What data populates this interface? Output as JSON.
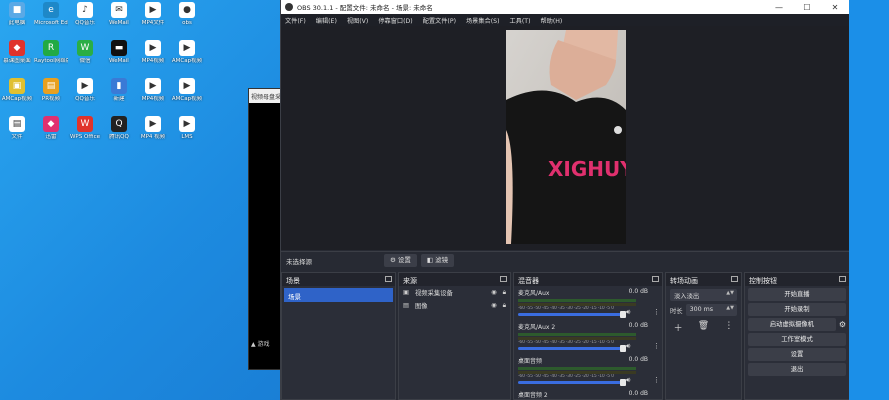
{
  "desktop": {
    "icons": [
      {
        "label": "此电脑",
        "color": "#5aa9e6",
        "glyph": "■"
      },
      {
        "label": "Microsoft Edge",
        "color": "#1e88c8",
        "glyph": "e"
      },
      {
        "label": "QQ音乐",
        "color": "#ffffff",
        "glyph": "♪"
      },
      {
        "label": "WeMail",
        "color": "#ffffff",
        "glyph": "✉"
      },
      {
        "label": "MP4文件",
        "color": "#ffffff",
        "glyph": "▶"
      },
      {
        "label": "obs",
        "color": "#ffffff",
        "glyph": "●"
      },
      {
        "label": "慕课图桌面",
        "color": "#e0332b",
        "glyph": "◆"
      },
      {
        "label": "Raytool网络版",
        "color": "#22aa44",
        "glyph": "R"
      },
      {
        "label": "微信",
        "color": "#2aae45",
        "glyph": "W"
      },
      {
        "label": "WeMail",
        "color": "#111111",
        "glyph": "▬"
      },
      {
        "label": "MP4视频",
        "color": "#ffffff",
        "glyph": "▶"
      },
      {
        "label": "AMCap视频",
        "color": "#ffffff",
        "glyph": "▶"
      },
      {
        "label": "AMCap视频",
        "color": "#e0c030",
        "glyph": "▣"
      },
      {
        "label": "PR视频",
        "color": "#e8a020",
        "glyph": "▤"
      },
      {
        "label": "QQ音乐",
        "color": "#ffffff",
        "glyph": "▶"
      },
      {
        "label": "新建",
        "color": "#3a7ad6",
        "glyph": "▮"
      },
      {
        "label": "MP4视频",
        "color": "#ffffff",
        "glyph": "▶"
      },
      {
        "label": "AMCap视频",
        "color": "#ffffff",
        "glyph": "▶"
      },
      {
        "label": "文件",
        "color": "#ffffff",
        "glyph": "▤"
      },
      {
        "label": "迅雷",
        "color": "#e03070",
        "glyph": "◆"
      },
      {
        "label": "WPS Office",
        "color": "#e0332b",
        "glyph": "W"
      },
      {
        "label": "腾讯QQ",
        "color": "#222222",
        "glyph": "Q"
      },
      {
        "label": "MP4 视频",
        "color": "#ffffff",
        "glyph": "▶"
      },
      {
        "label": "LMS",
        "color": "#ffffff",
        "glyph": "▶"
      }
    ]
  },
  "bg_window": {
    "title": "视频母盘采",
    "row": "游戏"
  },
  "obs": {
    "title": "OBS 30.1.1 - 配置文件: 未命名 - 场景: 未命名",
    "window_controls": [
      "—",
      "☐",
      "✕"
    ],
    "menu": [
      "文件(F)",
      "编辑(E)",
      "视图(V)",
      "停靠窗口(D)",
      "配置文件(P)",
      "场景集合(S)",
      "工具(T)",
      "帮助(H)"
    ],
    "preview": {
      "shirt_text": "XIGHUY"
    },
    "source_toolbar": {
      "no_source": "未选择源",
      "properties": "设置",
      "filters": "滤镜"
    },
    "scenes": {
      "header": "场景",
      "items": [
        "场景"
      ]
    },
    "sources": {
      "header": "来源",
      "items": [
        {
          "label": "视频采集设备",
          "icon": "▣"
        },
        {
          "label": "图像",
          "icon": "▤"
        }
      ]
    },
    "mixer": {
      "header": "混音器",
      "scale": "-60 -55 -50 -45 -40 -35 -30 -25 -20 -15 -10 -5 0",
      "channels": [
        {
          "name": "麦克风/Aux",
          "db": "0.0 dB",
          "level": 1.0
        },
        {
          "name": "麦克风/Aux 2",
          "db": "0.0 dB",
          "level": 1.0
        },
        {
          "name": "桌面音频",
          "db": "0.0 dB",
          "level": 1.0
        },
        {
          "name": "桌面音频 2",
          "db": "0.0 dB",
          "level": 1.0
        }
      ]
    },
    "transitions": {
      "header": "转场动画",
      "type": "淡入淡出",
      "duration_label": "时长",
      "duration": "300 ms"
    },
    "controls": {
      "header": "控制按钮",
      "buttons": [
        "开始直播",
        "开始录制",
        "启动虚拟摄像机",
        "工作室模式",
        "设置",
        "退出"
      ]
    }
  }
}
